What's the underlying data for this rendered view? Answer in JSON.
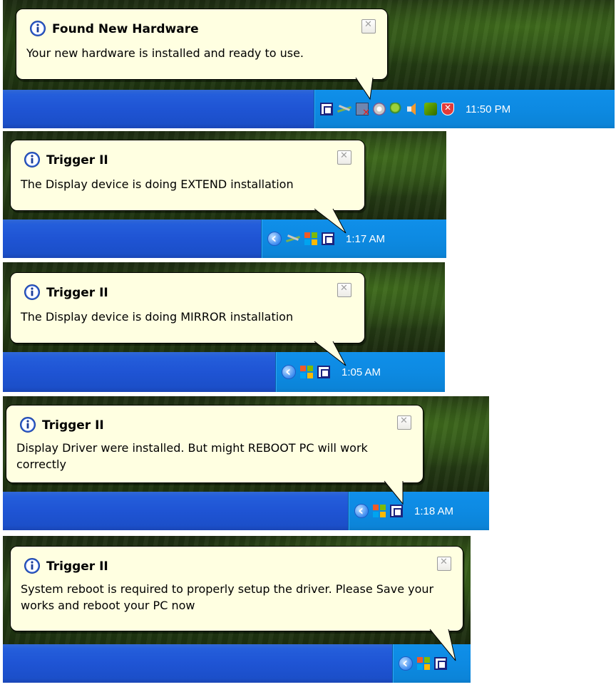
{
  "notifications": [
    {
      "title": "Found New Hardware",
      "message": "Your new hardware is installed and ready to use.",
      "clock": "11:50 PM",
      "tray_icons": [
        "display-device-icon",
        "network-icon",
        "network-disconnected-icon",
        "cd-drive-icon",
        "leaf-icon",
        "volume-icon",
        "nvidia-icon",
        "security-shield-icon"
      ]
    },
    {
      "title": "Trigger II",
      "message": "The Display device is doing EXTEND installation",
      "clock": "1:17 AM",
      "tray_icons": [
        "show-hidden-icons-icon",
        "network-icon",
        "windows-update-icon",
        "display-device-icon"
      ]
    },
    {
      "title": "Trigger II",
      "message": "The Display device is doing MIRROR installation",
      "clock": "1:05 AM",
      "tray_icons": [
        "show-hidden-icons-icon",
        "windows-update-icon",
        "display-device-icon"
      ]
    },
    {
      "title": "Trigger II",
      "message": "Display Driver were installed. But might REBOOT PC will work correctly",
      "clock": "1:18 AM",
      "tray_icons": [
        "show-hidden-icons-icon",
        "windows-update-icon",
        "display-device-icon"
      ]
    },
    {
      "title": "Trigger II",
      "message": "System reboot is required to properly setup the driver. Please Save your works and reboot your PC now",
      "clock": "",
      "tray_icons": [
        "show-hidden-icons-icon",
        "windows-update-icon",
        "display-device-icon"
      ]
    }
  ],
  "colors": {
    "balloon_background": "#ffffe1",
    "taskbar_blue": "#1f54d4",
    "tray_blue": "#0d8ae2",
    "info_icon_blue": "#2f5fd0"
  }
}
